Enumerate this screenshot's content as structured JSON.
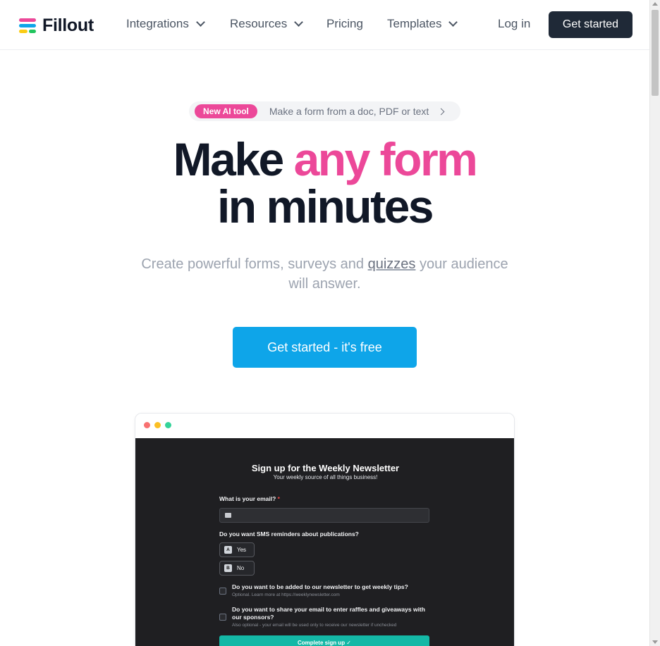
{
  "brand": {
    "name": "Fillout"
  },
  "nav": {
    "items": [
      {
        "label": "Integrations",
        "has_dropdown": true
      },
      {
        "label": "Resources",
        "has_dropdown": true
      },
      {
        "label": "Pricing",
        "has_dropdown": false
      },
      {
        "label": "Templates",
        "has_dropdown": true
      }
    ],
    "login": "Log in",
    "get_started": "Get started"
  },
  "announcement": {
    "badge": "New AI tool",
    "text": "Make a form from a doc, PDF or text"
  },
  "hero": {
    "title_part1": "Make ",
    "title_highlight": "any form",
    "title_line2": "in minutes",
    "subtitle_before": "Create powerful forms, surveys and ",
    "subtitle_link": "quizzes",
    "subtitle_after": " your audience",
    "subtitle_line2": "will answer.",
    "cta": "Get started - it's free"
  },
  "preview_form": {
    "title": "Sign up for the Weekly Newsletter",
    "subtitle": "Your weekly source of all things business!",
    "email_label": "What is your email?",
    "required_mark": "*",
    "sms_question": "Do you want SMS reminders about publications?",
    "options": [
      {
        "key": "A",
        "label": "Yes"
      },
      {
        "key": "B",
        "label": "No"
      }
    ],
    "checkbox1_label": "Do you want to be added to our newsletter to get weekly tips?",
    "checkbox1_hint": "Optional. Learn more at https://weeklynewsletter.com",
    "checkbox2_label": "Do you want to share your email to enter raffles and giveaways with our sponsors?",
    "checkbox2_hint": "Also optional - your email will be used only to receive our newsletter if unchecked",
    "submit": "Complete sign up ✓"
  },
  "colors": {
    "brand_pink": "#ec4899",
    "primary_blue": "#0ea5e9",
    "dark_button": "#1f2937",
    "submit_teal": "#14b8a6"
  }
}
